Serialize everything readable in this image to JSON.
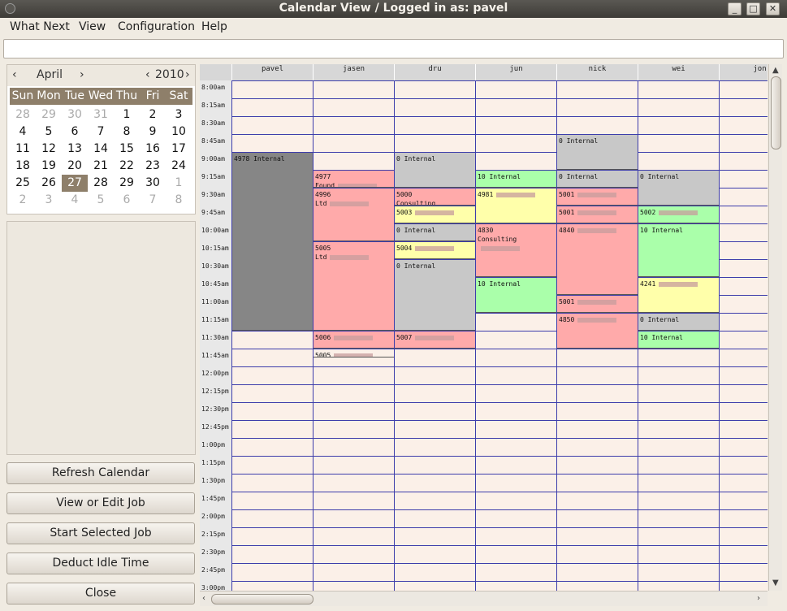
{
  "window": {
    "title": "Calendar View / Logged in as: pavel"
  },
  "menu": [
    "What Next",
    "View",
    "Configuration",
    "Help"
  ],
  "calendar": {
    "month": "April",
    "year": "2010",
    "dow": [
      "Sun",
      "Mon",
      "Tue",
      "Wed",
      "Thu",
      "Fri",
      "Sat"
    ],
    "weeks": [
      [
        "28",
        "29",
        "30",
        "31",
        "1",
        "2",
        "3"
      ],
      [
        "4",
        "5",
        "6",
        "7",
        "8",
        "9",
        "10"
      ],
      [
        "11",
        "12",
        "13",
        "14",
        "15",
        "16",
        "17"
      ],
      [
        "18",
        "19",
        "20",
        "21",
        "22",
        "23",
        "24"
      ],
      [
        "25",
        "26",
        "27",
        "28",
        "29",
        "30",
        "1"
      ],
      [
        "2",
        "3",
        "4",
        "5",
        "6",
        "7",
        "8"
      ]
    ],
    "selected_day": "27"
  },
  "buttons": [
    "Refresh Calendar",
    "View or Edit Job",
    "Start Selected Job",
    "Deduct Idle Time",
    "Close"
  ],
  "users": [
    "pavel",
    "jasen",
    "dru",
    "jun",
    "nick",
    "wei",
    "jon"
  ],
  "times": [
    "8:00am",
    "8:15am",
    "8:30am",
    "8:45am",
    "9:00am",
    "9:15am",
    "9:30am",
    "9:45am",
    "10:00am",
    "10:15am",
    "10:30am",
    "10:45am",
    "11:00am",
    "11:15am",
    "11:30am",
    "11:45am",
    "12:00pm",
    "12:15pm",
    "12:30pm",
    "12:45pm",
    "1:00pm",
    "1:15pm",
    "1:30pm",
    "1:45pm",
    "2:00pm",
    "2:15pm",
    "2:30pm",
    "2:45pm",
    "3:00pm"
  ],
  "colors": {
    "internal_gray": "#c8c8c8",
    "pavel_block": "#868686",
    "pink": "#ffaaaa",
    "yellow": "#ffffaa",
    "green": "#aaffaa"
  },
  "events": [
    {
      "col": 0,
      "start": 4,
      "span": 10,
      "text": "4978 Internal",
      "color": "#868686",
      "blur": 0
    },
    {
      "col": 1,
      "start": 5,
      "span": 1,
      "text": "4977\nFound",
      "color": "#ffaaaa",
      "blur": 1
    },
    {
      "col": 1,
      "start": 6,
      "span": 3,
      "text": "4996\nLtd",
      "color": "#ffaaaa",
      "blur": 1
    },
    {
      "col": 1,
      "start": 9,
      "span": 5,
      "text": "5005\nLtd",
      "color": "#ffaaaa",
      "blur": 1
    },
    {
      "col": 1,
      "start": 14,
      "span": 1,
      "text": "5006",
      "color": "#ffaaaa",
      "blur": 1
    },
    {
      "col": 1,
      "start": 15,
      "span": 0.5,
      "text": "5005",
      "color": "#fbf0e8",
      "blur": 1
    },
    {
      "col": 2,
      "start": 4,
      "span": 2,
      "text": "0 Internal",
      "color": "#c8c8c8",
      "blur": 0
    },
    {
      "col": 2,
      "start": 6,
      "span": 1,
      "text": "5000\nConsulting",
      "color": "#ffaaaa",
      "blur": 1
    },
    {
      "col": 2,
      "start": 7,
      "span": 1,
      "text": "5003",
      "color": "#ffffaa",
      "blur": 1
    },
    {
      "col": 2,
      "start": 8,
      "span": 1,
      "text": "0 Internal",
      "color": "#c8c8c8",
      "blur": 0
    },
    {
      "col": 2,
      "start": 9,
      "span": 1,
      "text": "5004",
      "color": "#ffffaa",
      "blur": 1
    },
    {
      "col": 2,
      "start": 10,
      "span": 4,
      "text": "0 Internal",
      "color": "#c8c8c8",
      "blur": 0
    },
    {
      "col": 2,
      "start": 14,
      "span": 1,
      "text": "5007",
      "color": "#ffaaaa",
      "blur": 1
    },
    {
      "col": 3,
      "start": 5,
      "span": 1,
      "text": "10 Internal",
      "color": "#aaffaa",
      "blur": 0
    },
    {
      "col": 3,
      "start": 6,
      "span": 2,
      "text": "4981",
      "color": "#ffffaa",
      "blur": 1
    },
    {
      "col": 3,
      "start": 8,
      "span": 3,
      "text": "4830\nConsulting",
      "color": "#ffaaaa",
      "blur": 1
    },
    {
      "col": 3,
      "start": 11,
      "span": 2,
      "text": "10 Internal",
      "color": "#aaffaa",
      "blur": 0
    },
    {
      "col": 4,
      "start": 3,
      "span": 2,
      "text": "0 Internal",
      "color": "#c8c8c8",
      "blur": 0
    },
    {
      "col": 4,
      "start": 5,
      "span": 1,
      "text": "0 Internal",
      "color": "#c8c8c8",
      "blur": 0
    },
    {
      "col": 4,
      "start": 6,
      "span": 1,
      "text": "5001",
      "color": "#ffaaaa",
      "blur": 1
    },
    {
      "col": 4,
      "start": 7,
      "span": 1,
      "text": "5001",
      "color": "#ffaaaa",
      "blur": 1
    },
    {
      "col": 4,
      "start": 8,
      "span": 4,
      "text": "4840",
      "color": "#ffaaaa",
      "blur": 1
    },
    {
      "col": 4,
      "start": 12,
      "span": 1,
      "text": "5001",
      "color": "#ffaaaa",
      "blur": 1
    },
    {
      "col": 4,
      "start": 13,
      "span": 2,
      "text": "4850",
      "color": "#ffaaaa",
      "blur": 1
    },
    {
      "col": 5,
      "start": 5,
      "span": 2,
      "text": "0 Internal",
      "color": "#c8c8c8",
      "blur": 0
    },
    {
      "col": 5,
      "start": 7,
      "span": 1,
      "text": "5002",
      "color": "#aaffaa",
      "blur": 1
    },
    {
      "col": 5,
      "start": 8,
      "span": 3,
      "text": "10 Internal",
      "color": "#aaffaa",
      "blur": 0
    },
    {
      "col": 5,
      "start": 11,
      "span": 2,
      "text": "4241",
      "color": "#ffffaa",
      "blur": 1
    },
    {
      "col": 5,
      "start": 13,
      "span": 1,
      "text": "0 Internal",
      "color": "#c8c8c8",
      "blur": 0
    },
    {
      "col": 5,
      "start": 14,
      "span": 1,
      "text": "10 Internal",
      "color": "#aaffaa",
      "blur": 0
    }
  ]
}
